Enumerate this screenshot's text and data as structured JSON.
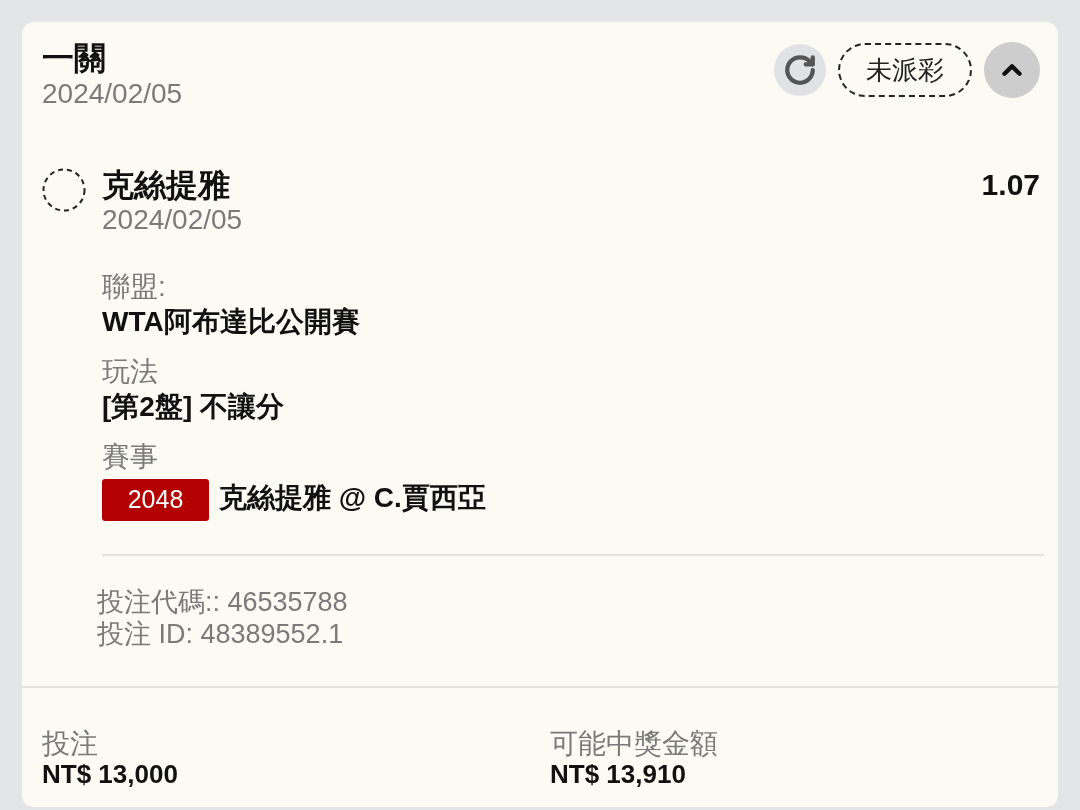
{
  "bet": {
    "title": "一關",
    "date": "2024/02/05",
    "status": "未派彩",
    "expanded": true
  },
  "selections": [
    {
      "name": "克絲提雅",
      "date": "2024/02/05",
      "odds": "1.07",
      "details": [
        {
          "label": "聯盟:",
          "value": "WTA阿布達比公開賽"
        },
        {
          "label": "玩法",
          "value": "[第2盤] 不讓分"
        },
        {
          "label": "賽事",
          "event_code": "2048",
          "value": "克絲提雅 @ C.賈西亞"
        }
      ]
    }
  ],
  "references": [
    "投注代碼:: 46535788",
    "投注 ID: 48389552.1"
  ],
  "totals": [
    {
      "label": "投注",
      "value": "NT$ 13,000"
    },
    {
      "label": "可能中獎金額",
      "value": "NT$ 13,910"
    }
  ]
}
